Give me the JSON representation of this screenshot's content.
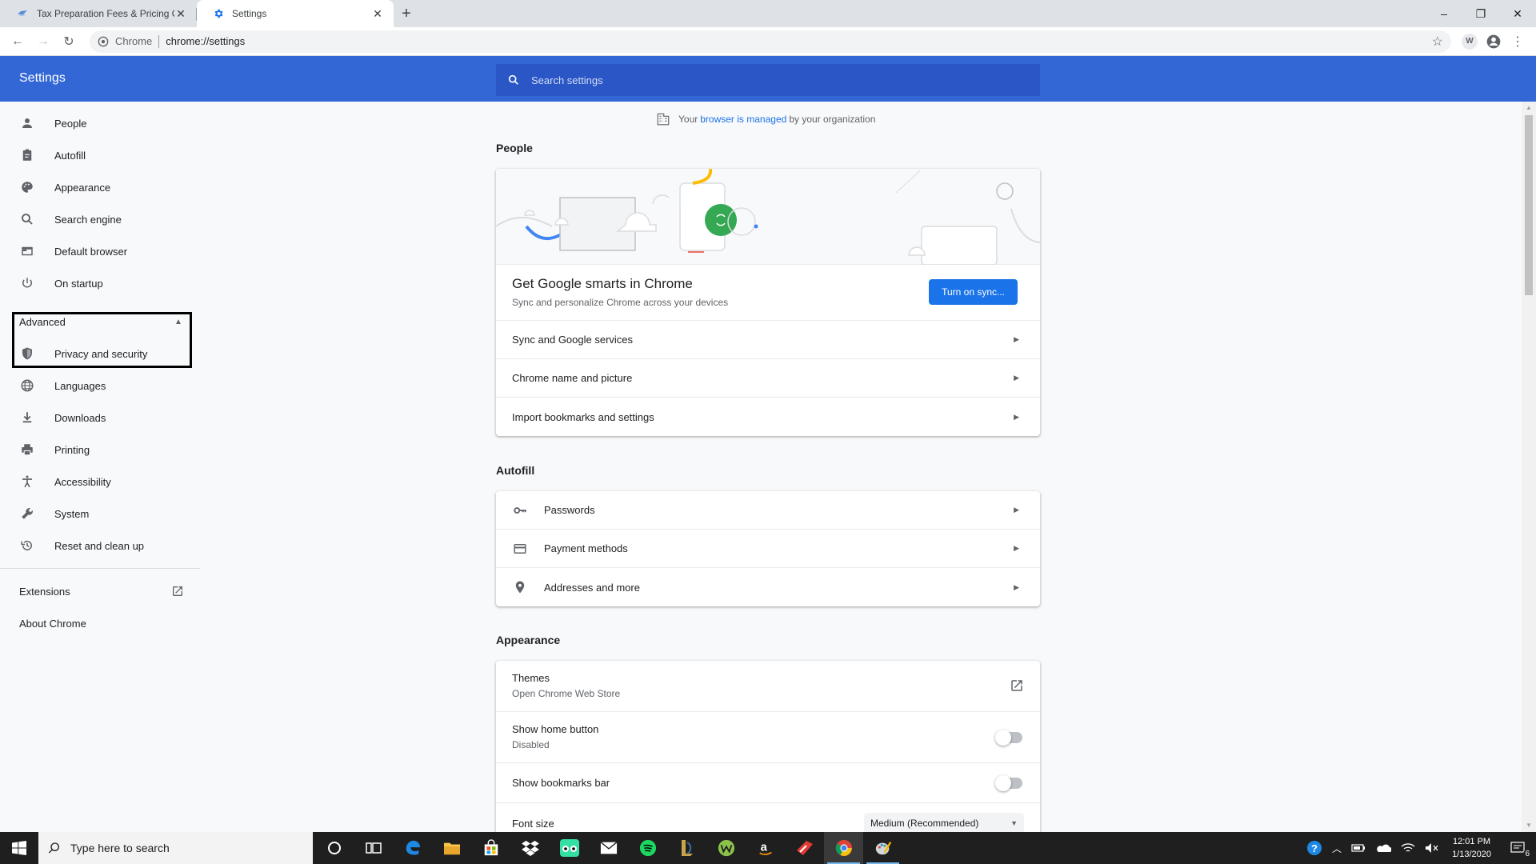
{
  "browser": {
    "tabs": [
      {
        "title": "Tax Preparation Fees & Pricing Op",
        "active": false
      },
      {
        "title": "Settings",
        "active": true
      }
    ],
    "omnibox": {
      "chip": "Chrome",
      "url": "chrome://settings"
    },
    "extension_badge": "W"
  },
  "settings": {
    "title": "Settings",
    "search_placeholder": "Search settings",
    "managed_notice": {
      "prefix": "Your",
      "link": "browser is managed",
      "suffix": "by your organization"
    }
  },
  "sidebar": {
    "items": [
      {
        "label": "People",
        "icon": "person-icon"
      },
      {
        "label": "Autofill",
        "icon": "clipboard-icon"
      },
      {
        "label": "Appearance",
        "icon": "palette-icon"
      },
      {
        "label": "Search engine",
        "icon": "search-icon"
      },
      {
        "label": "Default browser",
        "icon": "browser-window-icon"
      },
      {
        "label": "On startup",
        "icon": "power-icon"
      }
    ],
    "advanced_label": "Advanced",
    "advanced_items": [
      {
        "label": "Privacy and security",
        "icon": "shield-icon"
      },
      {
        "label": "Languages",
        "icon": "globe-icon"
      },
      {
        "label": "Downloads",
        "icon": "download-icon"
      },
      {
        "label": "Printing",
        "icon": "printer-icon"
      },
      {
        "label": "Accessibility",
        "icon": "accessibility-icon"
      },
      {
        "label": "System",
        "icon": "wrench-icon"
      },
      {
        "label": "Reset and clean up",
        "icon": "restore-icon"
      }
    ],
    "extensions": "Extensions",
    "about": "About Chrome"
  },
  "people": {
    "section_title": "People",
    "promo_title": "Get Google smarts in Chrome",
    "promo_subtitle": "Sync and personalize Chrome across your devices",
    "sync_button": "Turn on sync...",
    "rows": [
      "Sync and Google services",
      "Chrome name and picture",
      "Import bookmarks and settings"
    ]
  },
  "autofill": {
    "section_title": "Autofill",
    "rows": [
      {
        "label": "Passwords",
        "icon": "key-icon"
      },
      {
        "label": "Payment methods",
        "icon": "credit-card-icon"
      },
      {
        "label": "Addresses and more",
        "icon": "location-pin-icon"
      }
    ]
  },
  "appearance": {
    "section_title": "Appearance",
    "themes": {
      "label": "Themes",
      "sub": "Open Chrome Web Store"
    },
    "home_button": {
      "label": "Show home button",
      "sub": "Disabled"
    },
    "bookmarks_bar": {
      "label": "Show bookmarks bar"
    },
    "font_size": {
      "label": "Font size",
      "value": "Medium (Recommended)"
    }
  },
  "taskbar": {
    "search_placeholder": "Type here to search",
    "time": "12:01 PM",
    "date": "1/13/2020",
    "notification_count": "6"
  },
  "colors": {
    "accent": "#3367d6",
    "button": "#1a73e8",
    "link": "#1a73e8"
  }
}
